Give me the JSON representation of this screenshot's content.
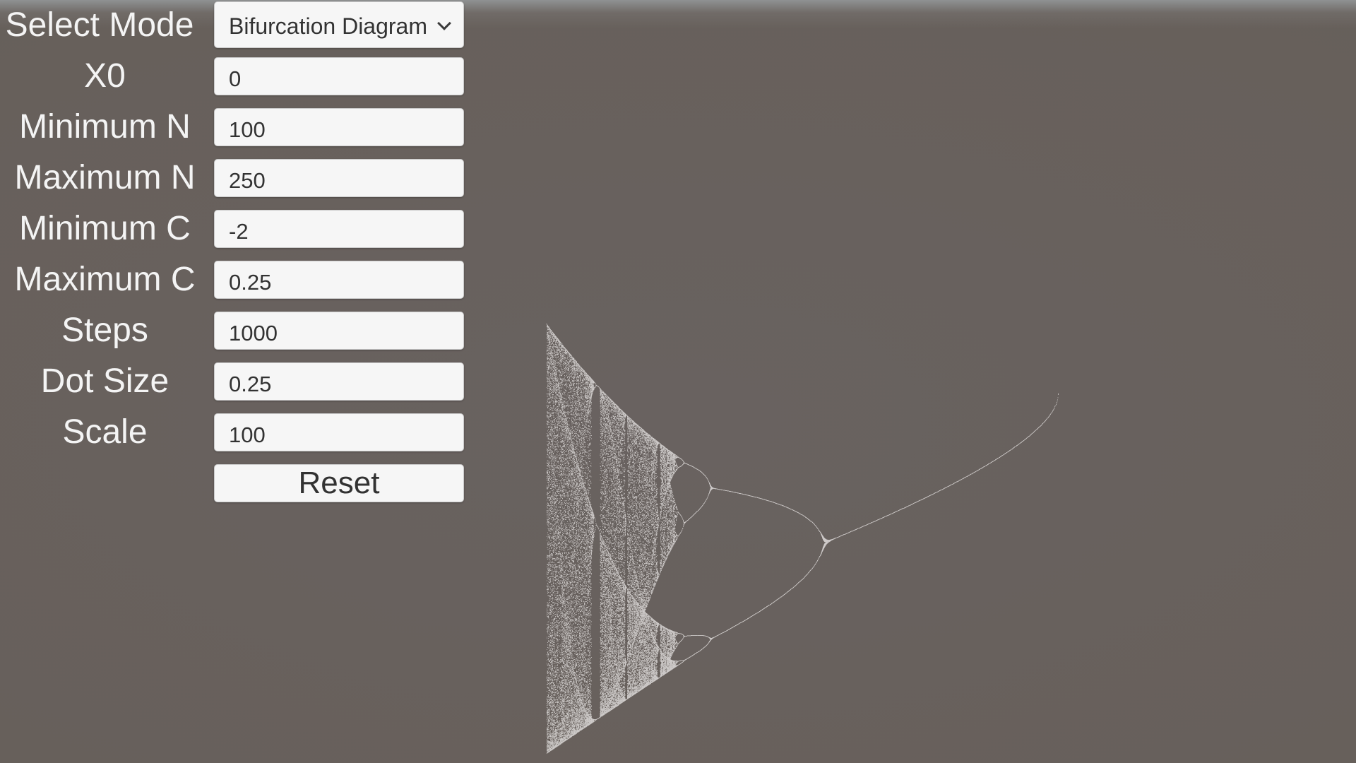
{
  "panel": {
    "mode": {
      "label": "Select Mode",
      "value": "Bifurcation Diagram"
    },
    "fields": [
      {
        "id": "x0",
        "label": "X0",
        "value": "0"
      },
      {
        "id": "min-n",
        "label": "Minimum N",
        "value": "100"
      },
      {
        "id": "max-n",
        "label": "Maximum N",
        "value": "250"
      },
      {
        "id": "min-c",
        "label": "Minimum C",
        "value": "-2"
      },
      {
        "id": "max-c",
        "label": "Maximum C",
        "value": "0.25"
      },
      {
        "id": "steps",
        "label": "Steps",
        "value": "1000"
      },
      {
        "id": "dot-size",
        "label": "Dot Size",
        "value": "0.25"
      },
      {
        "id": "scale",
        "label": "Scale",
        "value": "100"
      }
    ],
    "reset_label": "Reset"
  },
  "icons": {
    "dropdown": "chevron-down-icon"
  },
  "colors": {
    "background": "#67605b",
    "dots": "#e4e2e0",
    "field_bg": "#f6f6f6",
    "label_text": "#f4f4f4",
    "field_text": "#323232"
  }
}
